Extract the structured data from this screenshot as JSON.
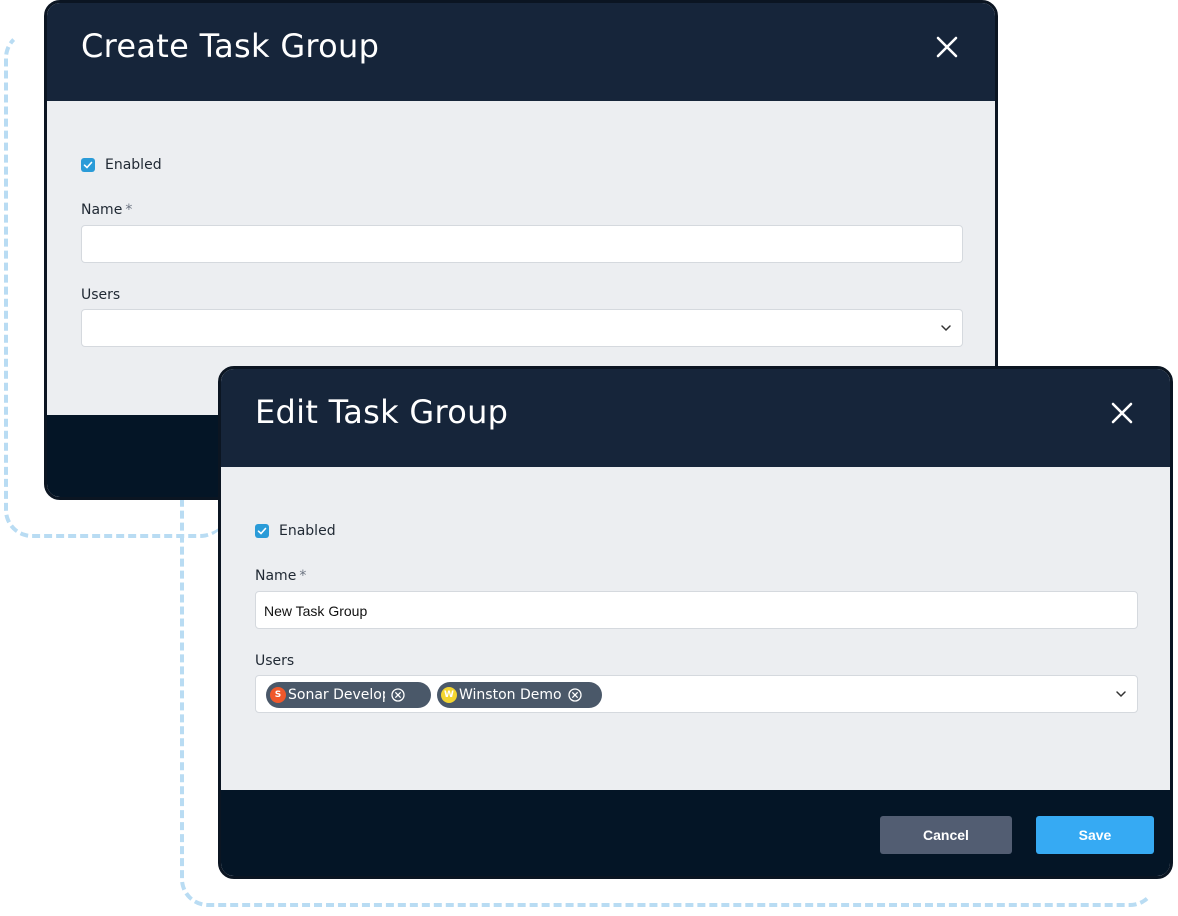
{
  "colors": {
    "header_bg": "#16253a",
    "footer_bg": "#041526",
    "body_bg": "#eceef1",
    "checkbox": "#2a9bd8",
    "chip_bg": "#4a5869",
    "cancel_bg": "#525d72",
    "save_bg": "#36aaf3",
    "dash": "#b9dcf3"
  },
  "create_modal": {
    "title": "Create Task Group",
    "enabled_label": "Enabled",
    "enabled_checked": true,
    "name_label": "Name",
    "required_mark": "*",
    "name_value": "",
    "users_label": "Users",
    "icons": {
      "close": "close-icon",
      "dropdown": "chevron-down-icon",
      "check": "check-icon"
    }
  },
  "edit_modal": {
    "title": "Edit Task Group",
    "enabled_label": "Enabled",
    "enabled_checked": true,
    "name_label": "Name",
    "required_mark": "*",
    "name_value": "New Task Group",
    "users_label": "Users",
    "selected_users": [
      {
        "initial": "S",
        "name": "Sonar Develop",
        "avatar_color": "#f0582b"
      },
      {
        "initial": "W",
        "name": "Winston Demo",
        "avatar_color": "#f3d530"
      }
    ],
    "cancel_label": "Cancel",
    "save_label": "Save",
    "icons": {
      "close": "close-icon",
      "dropdown": "chevron-down-icon",
      "check": "check-icon",
      "remove": "remove-circle-icon"
    }
  }
}
